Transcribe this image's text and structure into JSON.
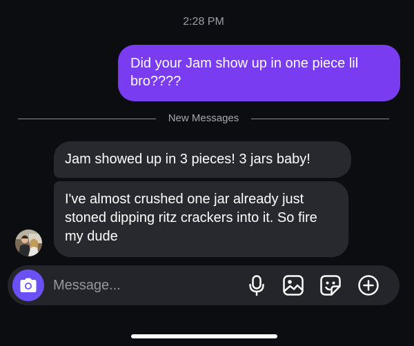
{
  "conversation": {
    "timestamp": "2:28 PM",
    "outgoing_messages": [
      {
        "text": "Did your Jam show up in one piece lil bro????"
      }
    ],
    "divider_label": "New Messages",
    "incoming_messages": [
      {
        "text": "Jam showed up in 3 pieces! 3 jars baby!"
      },
      {
        "text": "I've almost crushed one jar already just stoned dipping ritz crackers into it. So fire my dude"
      }
    ]
  },
  "composer": {
    "placeholder": "Message...",
    "icons": [
      "camera-icon",
      "microphone-icon",
      "gallery-icon",
      "sticker-icon",
      "add-icon"
    ]
  },
  "colors": {
    "background": "#0c0d10",
    "outgoing_bubble": "#7a3cf0",
    "incoming_bubble": "#28292e",
    "camera_button": "#6b50f5",
    "composer_bg": "#24252a"
  }
}
